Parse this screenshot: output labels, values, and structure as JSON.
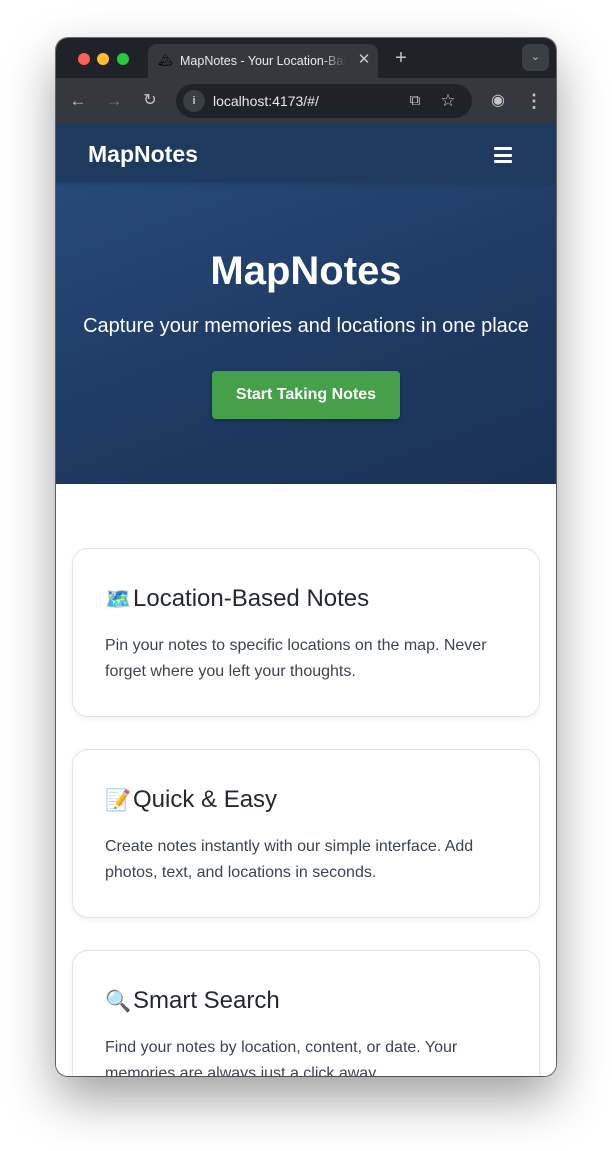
{
  "browser": {
    "tab_title": "MapNotes - Your Location-Based Notes",
    "tab_favicon": "🏔",
    "tab_close": "✕",
    "new_tab": "+",
    "tab_menu": "⌄",
    "url": "localhost:4173/#/",
    "icons": {
      "back": "←",
      "forward": "→",
      "reload": "↻",
      "site_info": "i",
      "install": "⧉",
      "bookmark": "☆",
      "profile": "◉",
      "menu": "⋮"
    }
  },
  "navbar": {
    "brand": "MapNotes",
    "menu_icon": "hamburger-icon"
  },
  "hero": {
    "title": "MapNotes",
    "subtitle": "Capture your memories and locations in one place",
    "cta_label": "Start Taking Notes"
  },
  "features": [
    {
      "icon": "🗺️",
      "title": "Location-Based Notes",
      "description": "Pin your notes to specific locations on the map. Never forget where you left your thoughts."
    },
    {
      "icon": "📝",
      "title": "Quick & Easy",
      "description": "Create notes instantly with our simple interface. Add photos, text, and locations in seconds."
    },
    {
      "icon": "🔍",
      "title": "Smart Search",
      "description": "Find your notes by location, content, or date. Your memories are always just a click away."
    }
  ],
  "colors": {
    "navbar": "#1e3a5f",
    "hero": "#1e3a63",
    "cta": "#45a049",
    "browser_chrome": "#35393f"
  }
}
